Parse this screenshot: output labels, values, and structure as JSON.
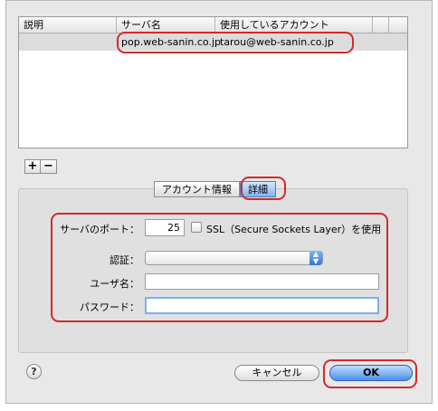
{
  "accounts_table": {
    "columns": [
      "説明",
      "サーバ名",
      "使用しているアカウント"
    ],
    "rows": [
      {
        "description": "",
        "server": "pop.web-sanin.co.jp",
        "account": "tarou@web-sanin.co.jp"
      }
    ]
  },
  "list_buttons": {
    "add": "+",
    "remove": "−"
  },
  "tabs": {
    "account_info": "アカウント情報",
    "details": "詳細",
    "active": "details"
  },
  "form": {
    "server_port_label": "サーバのポート：",
    "server_port_value": "25",
    "ssl_label": "SSL（Secure Sockets Layer）を使用",
    "ssl_checked": false,
    "auth_label": "認証：",
    "auth_value": "",
    "username_label": "ユーザ名：",
    "username_value": "",
    "password_label": "パスワード：",
    "password_value": ""
  },
  "buttons": {
    "help": "?",
    "cancel": "キャンセル",
    "ok": "OK"
  },
  "colors": {
    "highlight": "#d22a2a",
    "accent": "#4a90e8"
  }
}
